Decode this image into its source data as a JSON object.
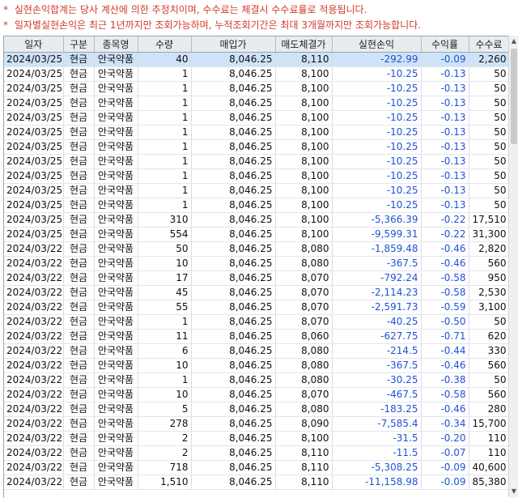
{
  "notices": [
    {
      "marker": "*",
      "text": "실현손익합계는 당사 계산에 의한 추정치이며, 수수료는 체결시 수수료률로 적용됩니다."
    },
    {
      "marker": "*",
      "text": "일자별실현손익은 최근 1년까지만 조회가능하며, 누적조회기간은 최대 3개월까지만 조회가능합니다."
    }
  ],
  "colors": {
    "notice": "#d23a2a",
    "negative": "#1e53d6",
    "selected_row": "#cfe3f7",
    "header_bg": "#e9ecef"
  },
  "table": {
    "columns": [
      "일자",
      "구분",
      "종목명",
      "수량",
      "매입가",
      "매도체결가",
      "실현손익",
      "수익률",
      "수수료"
    ],
    "rows": [
      [
        "2024/03/25",
        "현금",
        "안국약품",
        "40",
        "8,046.25",
        "8,110",
        "-292.99",
        "-0.09",
        "2,260"
      ],
      [
        "2024/03/25",
        "현금",
        "안국약품",
        "1",
        "8,046.25",
        "8,100",
        "-10.25",
        "-0.13",
        "50"
      ],
      [
        "2024/03/25",
        "현금",
        "안국약품",
        "1",
        "8,046.25",
        "8,100",
        "-10.25",
        "-0.13",
        "50"
      ],
      [
        "2024/03/25",
        "현금",
        "안국약품",
        "1",
        "8,046.25",
        "8,100",
        "-10.25",
        "-0.13",
        "50"
      ],
      [
        "2024/03/25",
        "현금",
        "안국약품",
        "1",
        "8,046.25",
        "8,100",
        "-10.25",
        "-0.13",
        "50"
      ],
      [
        "2024/03/25",
        "현금",
        "안국약품",
        "1",
        "8,046.25",
        "8,100",
        "-10.25",
        "-0.13",
        "50"
      ],
      [
        "2024/03/25",
        "현금",
        "안국약품",
        "1",
        "8,046.25",
        "8,100",
        "-10.25",
        "-0.13",
        "50"
      ],
      [
        "2024/03/25",
        "현금",
        "안국약품",
        "1",
        "8,046.25",
        "8,100",
        "-10.25",
        "-0.13",
        "50"
      ],
      [
        "2024/03/25",
        "현금",
        "안국약품",
        "1",
        "8,046.25",
        "8,100",
        "-10.25",
        "-0.13",
        "50"
      ],
      [
        "2024/03/25",
        "현금",
        "안국약품",
        "1",
        "8,046.25",
        "8,100",
        "-10.25",
        "-0.13",
        "50"
      ],
      [
        "2024/03/25",
        "현금",
        "안국약품",
        "1",
        "8,046.25",
        "8,100",
        "-10.25",
        "-0.13",
        "50"
      ],
      [
        "2024/03/25",
        "현금",
        "안국약품",
        "310",
        "8,046.25",
        "8,100",
        "-5,366.39",
        "-0.22",
        "17,510"
      ],
      [
        "2024/03/25",
        "현금",
        "안국약품",
        "554",
        "8,046.25",
        "8,100",
        "-9,599.31",
        "-0.22",
        "31,300"
      ],
      [
        "2024/03/22",
        "현금",
        "안국약품",
        "50",
        "8,046.25",
        "8,080",
        "-1,859.48",
        "-0.46",
        "2,820"
      ],
      [
        "2024/03/22",
        "현금",
        "안국약품",
        "10",
        "8,046.25",
        "8,080",
        "-367.5",
        "-0.46",
        "560"
      ],
      [
        "2024/03/22",
        "현금",
        "안국약품",
        "17",
        "8,046.25",
        "8,070",
        "-792.24",
        "-0.58",
        "950"
      ],
      [
        "2024/03/22",
        "현금",
        "안국약품",
        "45",
        "8,046.25",
        "8,070",
        "-2,114.23",
        "-0.58",
        "2,530"
      ],
      [
        "2024/03/22",
        "현금",
        "안국약품",
        "55",
        "8,046.25",
        "8,070",
        "-2,591.73",
        "-0.59",
        "3,100"
      ],
      [
        "2024/03/22",
        "현금",
        "안국약품",
        "1",
        "8,046.25",
        "8,070",
        "-40.25",
        "-0.50",
        "50"
      ],
      [
        "2024/03/22",
        "현금",
        "안국약품",
        "11",
        "8,046.25",
        "8,060",
        "-627.75",
        "-0.71",
        "620"
      ],
      [
        "2024/03/22",
        "현금",
        "안국약품",
        "6",
        "8,046.25",
        "8,080",
        "-214.5",
        "-0.44",
        "330"
      ],
      [
        "2024/03/22",
        "현금",
        "안국약품",
        "10",
        "8,046.25",
        "8,080",
        "-367.5",
        "-0.46",
        "560"
      ],
      [
        "2024/03/22",
        "현금",
        "안국약품",
        "1",
        "8,046.25",
        "8,080",
        "-30.25",
        "-0.38",
        "50"
      ],
      [
        "2024/03/22",
        "현금",
        "안국약품",
        "10",
        "8,046.25",
        "8,070",
        "-467.5",
        "-0.58",
        "560"
      ],
      [
        "2024/03/22",
        "현금",
        "안국약품",
        "5",
        "8,046.25",
        "8,080",
        "-183.25",
        "-0.46",
        "280"
      ],
      [
        "2024/03/22",
        "현금",
        "안국약품",
        "278",
        "8,046.25",
        "8,090",
        "-7,585.4",
        "-0.34",
        "15,700"
      ],
      [
        "2024/03/22",
        "현금",
        "안국약품",
        "2",
        "8,046.25",
        "8,100",
        "-31.5",
        "-0.20",
        "110"
      ],
      [
        "2024/03/22",
        "현금",
        "안국약품",
        "2",
        "8,046.25",
        "8,110",
        "-11.5",
        "-0.07",
        "110"
      ],
      [
        "2024/03/22",
        "현금",
        "안국약품",
        "718",
        "8,046.25",
        "8,110",
        "-5,308.25",
        "-0.09",
        "40,600"
      ],
      [
        "2024/03/22",
        "현금",
        "안국약품",
        "1,510",
        "8,046.25",
        "8,110",
        "-11,158.98",
        "-0.09",
        "85,380"
      ]
    ]
  }
}
